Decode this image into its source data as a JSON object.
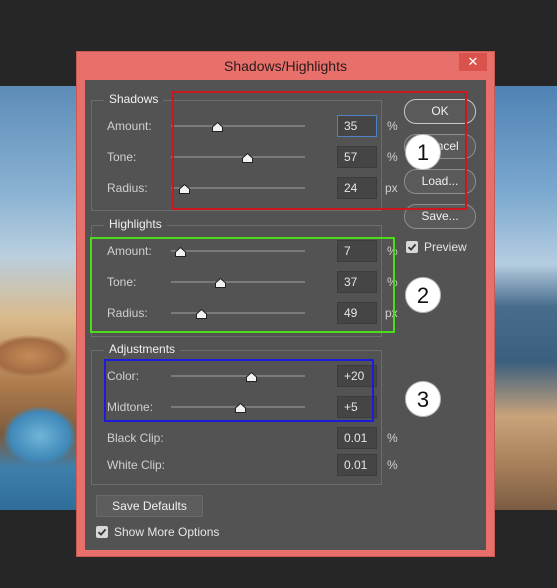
{
  "dialog": {
    "title": "Shadows/Highlights",
    "close_glyph": "✕"
  },
  "shadows": {
    "title": "Shadows",
    "amount": {
      "label": "Amount:",
      "value": "35",
      "unit": "%",
      "level": 0.35
    },
    "tone": {
      "label": "Tone:",
      "value": "57",
      "unit": "%",
      "level": 0.57
    },
    "radius": {
      "label": "Radius:",
      "value": "24",
      "unit": "px",
      "level": 0.1
    }
  },
  "highlights": {
    "title": "Highlights",
    "amount": {
      "label": "Amount:",
      "value": "7",
      "unit": "%",
      "level": 0.07
    },
    "tone": {
      "label": "Tone:",
      "value": "37",
      "unit": "%",
      "level": 0.37
    },
    "radius": {
      "label": "Radius:",
      "value": "49",
      "unit": "px",
      "level": 0.23
    }
  },
  "adjustments": {
    "title": "Adjustments",
    "color": {
      "label": "Color:",
      "value": "+20",
      "level": 0.6
    },
    "midtone": {
      "label": "Midtone:",
      "value": "+5",
      "level": 0.52
    },
    "black_clip": {
      "label": "Black Clip:",
      "value": "0.01",
      "unit": "%"
    },
    "white_clip": {
      "label": "White Clip:",
      "value": "0.01",
      "unit": "%"
    }
  },
  "buttons": {
    "ok": "OK",
    "cancel": "Cancel",
    "load": "Load...",
    "save": "Save...",
    "save_defaults": "Save Defaults"
  },
  "preview": {
    "label": "Preview",
    "checked": true
  },
  "show_more": {
    "label": "Show More Options",
    "checked": true
  },
  "annotations": {
    "one": "1",
    "two": "2",
    "three": "3",
    "colors": {
      "one": "#c8191e",
      "two": "#4cdc1c",
      "three": "#1b1bd9"
    }
  }
}
